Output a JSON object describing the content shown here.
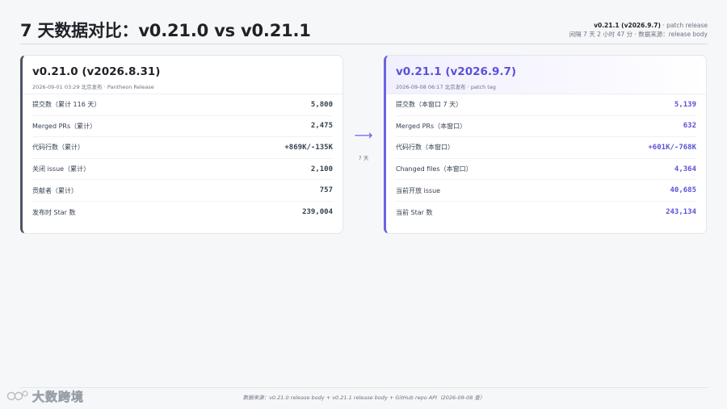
{
  "header": {
    "title": "7 天数据对比：v0.21.0 vs v0.21.1",
    "meta_version": "v0.21.1 (v2026.9.7)",
    "meta_tag": "· patch release",
    "meta_line2": "间隔 7 天 2 小时 47 分 · 数据来源：release body"
  },
  "left_card": {
    "title": "v0.21.0 (v2026.8.31)",
    "subtitle": "2026-09-01 03:29 北京发布 · Pantheon Release",
    "rows": [
      {
        "label": "提交数（累计 116 天）",
        "value": "5,800"
      },
      {
        "label": "Merged PRs（累计）",
        "value": "2,475"
      },
      {
        "label": "代码行数（累计）",
        "value": "+869K/-135K"
      },
      {
        "label": "关闭 issue（累计）",
        "value": "2,100"
      },
      {
        "label": "贡献者（累计）",
        "value": "757"
      },
      {
        "label": "发布时 Star 数",
        "value": "239,004"
      }
    ]
  },
  "right_card": {
    "title": "v0.21.1 (v2026.9.7)",
    "subtitle": "2026-09-08 06:17 北京发布 · patch tag",
    "rows": [
      {
        "label": "提交数（本窗口 7 天）",
        "value": "5,139"
      },
      {
        "label": "Merged PRs（本窗口）",
        "value": "632"
      },
      {
        "label": "代码行数（本窗口）",
        "value": "+601K/-768K"
      },
      {
        "label": "Changed files（本窗口）",
        "value": "4,364"
      },
      {
        "label": "当前开放 issue",
        "value": "40,685"
      },
      {
        "label": "当前 Star 数",
        "value": "243,134"
      }
    ]
  },
  "arrow": {
    "glyph": "⟶",
    "label": "7 天"
  },
  "footer": {
    "text": "数据来源：v0.21.0 release body + v0.21.1 release body + GitHub repo API（2026-09-08 查）"
  },
  "watermark": {
    "text": "大数跨境"
  },
  "colors": {
    "accent": "#6c63e6",
    "dark_border": "#4b5563"
  }
}
